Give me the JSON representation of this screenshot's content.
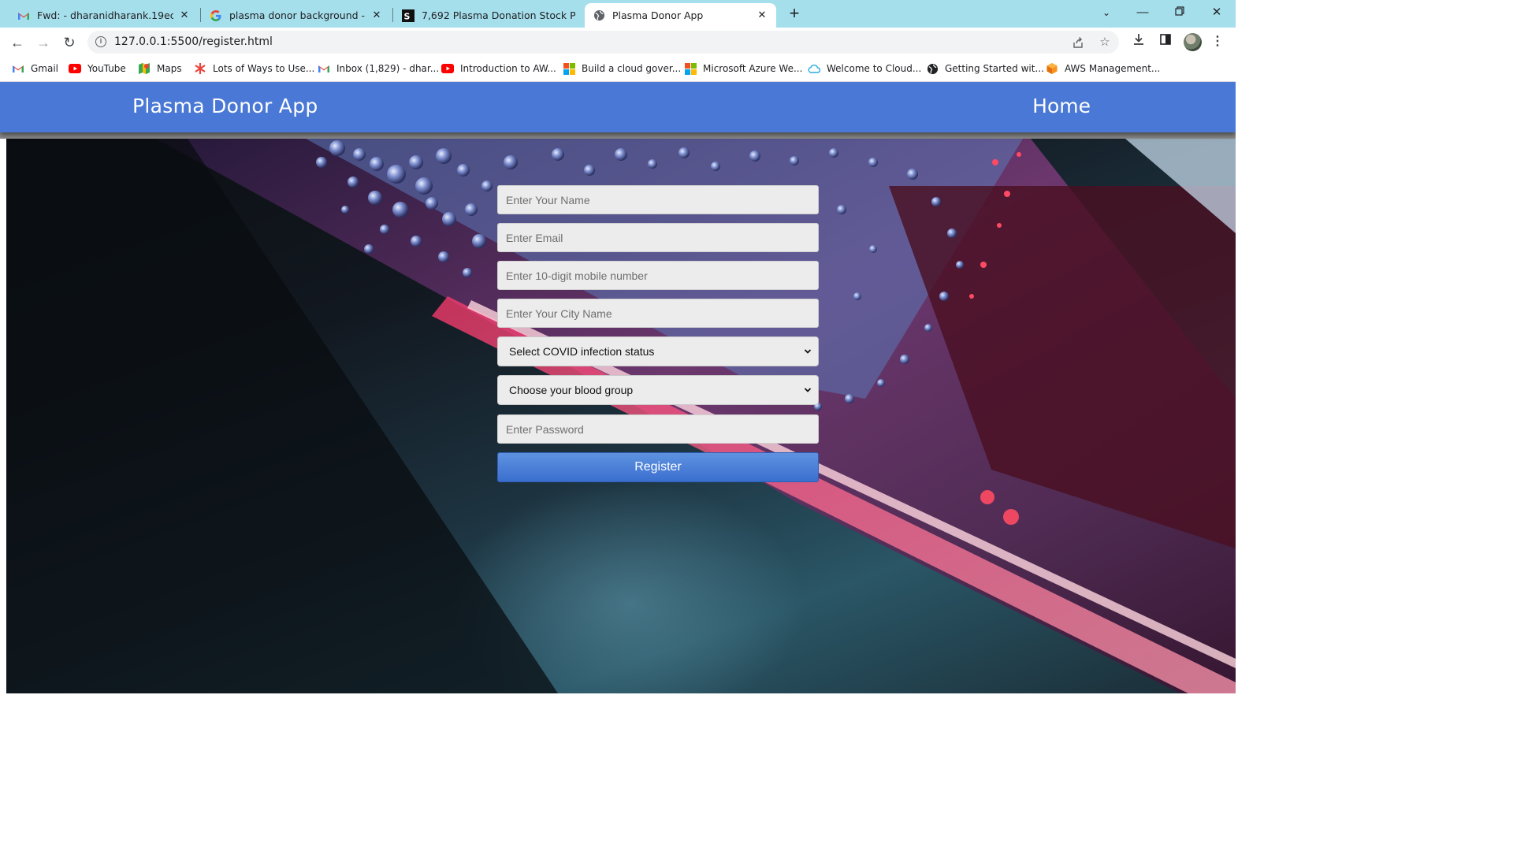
{
  "browser": {
    "tabs": [
      {
        "title": "Fwd: - dharanidharank.19ece@kc",
        "icon": "gmail-icon"
      },
      {
        "title": "plasma donor background - Goo",
        "icon": "google-icon"
      },
      {
        "title": "7,692 Plasma Donation Stock Pho",
        "icon": "shutterstock-icon"
      },
      {
        "title": "Plasma Donor App",
        "icon": "globe-icon",
        "active": true
      }
    ],
    "url": "127.0.0.1:5500/register.html",
    "bookmarks": [
      {
        "label": "Gmail",
        "icon": "gmail-icon"
      },
      {
        "label": "YouTube",
        "icon": "youtube-icon"
      },
      {
        "label": "Maps",
        "icon": "maps-icon"
      },
      {
        "label": "Lots of Ways to Use...",
        "icon": "asterisk-icon"
      },
      {
        "label": "Inbox (1,829) - dhar...",
        "icon": "gmail-icon"
      },
      {
        "label": "Introduction to AW...",
        "icon": "youtube-icon"
      },
      {
        "label": "Build a cloud gover...",
        "icon": "microsoft-icon"
      },
      {
        "label": "Microsoft Azure We...",
        "icon": "microsoft-icon"
      },
      {
        "label": "Welcome to Cloud...",
        "icon": "cloud-icon"
      },
      {
        "label": "Getting Started wit...",
        "icon": "globe-icon"
      },
      {
        "label": "AWS Management...",
        "icon": "aws-cube-icon"
      }
    ]
  },
  "navbar": {
    "brand": "Plasma Donor App",
    "home": "Home",
    "color": "#4a78d6"
  },
  "form": {
    "name_placeholder": "Enter Your Name",
    "email_placeholder": "Enter Email",
    "mobile_placeholder": "Enter 10-digit mobile number",
    "city_placeholder": "Enter Your City Name",
    "covid_select": "Select COVID infection status",
    "blood_select": "Choose your blood group",
    "password_placeholder": "Enter Password",
    "register_label": "Register"
  }
}
